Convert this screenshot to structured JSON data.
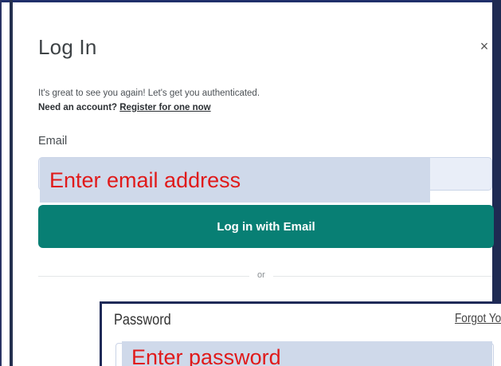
{
  "modal": {
    "title": "Log In",
    "close_glyph": "×",
    "intro": "It's great to see you again! Let's get you authenticated.",
    "need_account_prefix": "Need an account? ",
    "register_link": "Register for one now"
  },
  "email": {
    "label": "Email",
    "placeholder": "Enter email address"
  },
  "login_button": {
    "label": "Log in with Email"
  },
  "divider": {
    "text": "or"
  },
  "password": {
    "label": "Password",
    "forgot_link": "Forgot Yo",
    "placeholder": "Enter password"
  },
  "colors": {
    "accent": "#087f74",
    "annotation_text": "#e01a1a",
    "annotation_fill": "#cfd9ea",
    "frame_border": "#1f2f6a"
  },
  "icons": {
    "close": "close-icon"
  }
}
